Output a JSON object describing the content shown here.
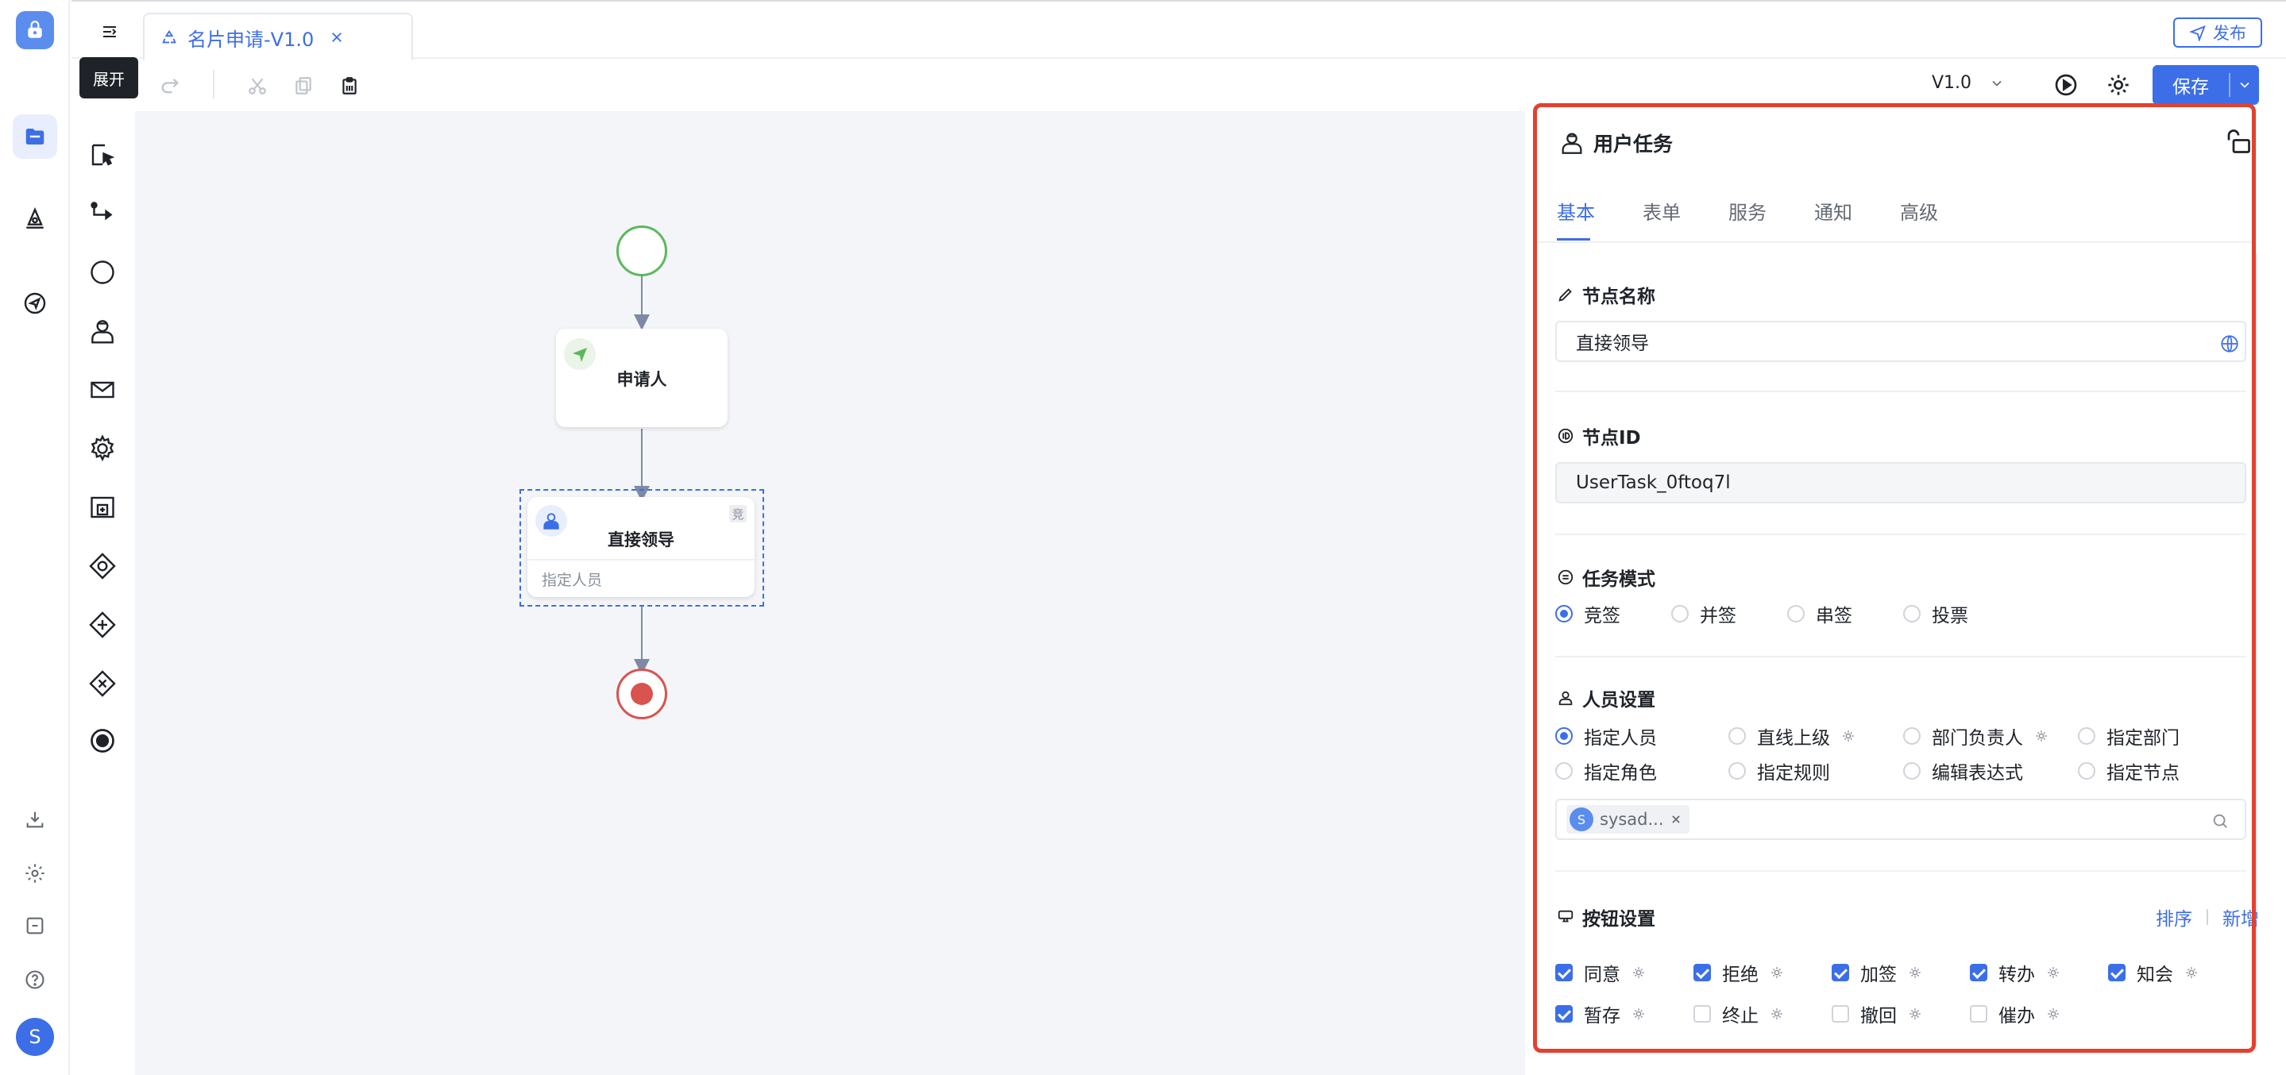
{
  "app": {
    "tab_title": "名片申请-V1.0",
    "publish_label": "发布",
    "expand_tooltip": "展开",
    "version": "V1.0",
    "save_label": "保存"
  },
  "rail": {
    "avatar_letter": "S"
  },
  "diagram": {
    "applicant_label": "申请人",
    "manager_label": "直接领导",
    "manager_sub": "指定人员",
    "manager_badge": "竞"
  },
  "panel": {
    "title": "用户任务",
    "tabs": [
      "基本",
      "表单",
      "服务",
      "通知",
      "高级"
    ],
    "active_tab": "基本",
    "node_name_label": "节点名称",
    "node_name_value": "直接领导",
    "node_id_label": "节点ID",
    "node_id_value": "UserTask_0ftoq7l",
    "task_mode_label": "任务模式",
    "task_modes": [
      "竞签",
      "并签",
      "串签",
      "投票"
    ],
    "task_mode_selected": "竞签",
    "people_label": "人员设置",
    "people_options": [
      "指定人员",
      "直线上级",
      "部门负责人",
      "指定部门",
      "指定角色",
      "指定规则",
      "编辑表达式",
      "指定节点"
    ],
    "people_selected": "指定人员",
    "selected_user_letter": "S",
    "selected_user": "sysad...",
    "buttons_label": "按钮设置",
    "sort_link": "排序",
    "add_link": "新增",
    "buttons": [
      {
        "label": "同意",
        "checked": true
      },
      {
        "label": "拒绝",
        "checked": true
      },
      {
        "label": "加签",
        "checked": true
      },
      {
        "label": "转办",
        "checked": true
      },
      {
        "label": "知会",
        "checked": true
      },
      {
        "label": "暂存",
        "checked": true
      },
      {
        "label": "终止",
        "checked": false
      },
      {
        "label": "撤回",
        "checked": false
      },
      {
        "label": "催办",
        "checked": false
      }
    ]
  },
  "colors": {
    "accent": "#3c6ee8",
    "highlight_border": "#e5402f",
    "start_event": "#5cb85c",
    "end_event": "#d9534f"
  }
}
